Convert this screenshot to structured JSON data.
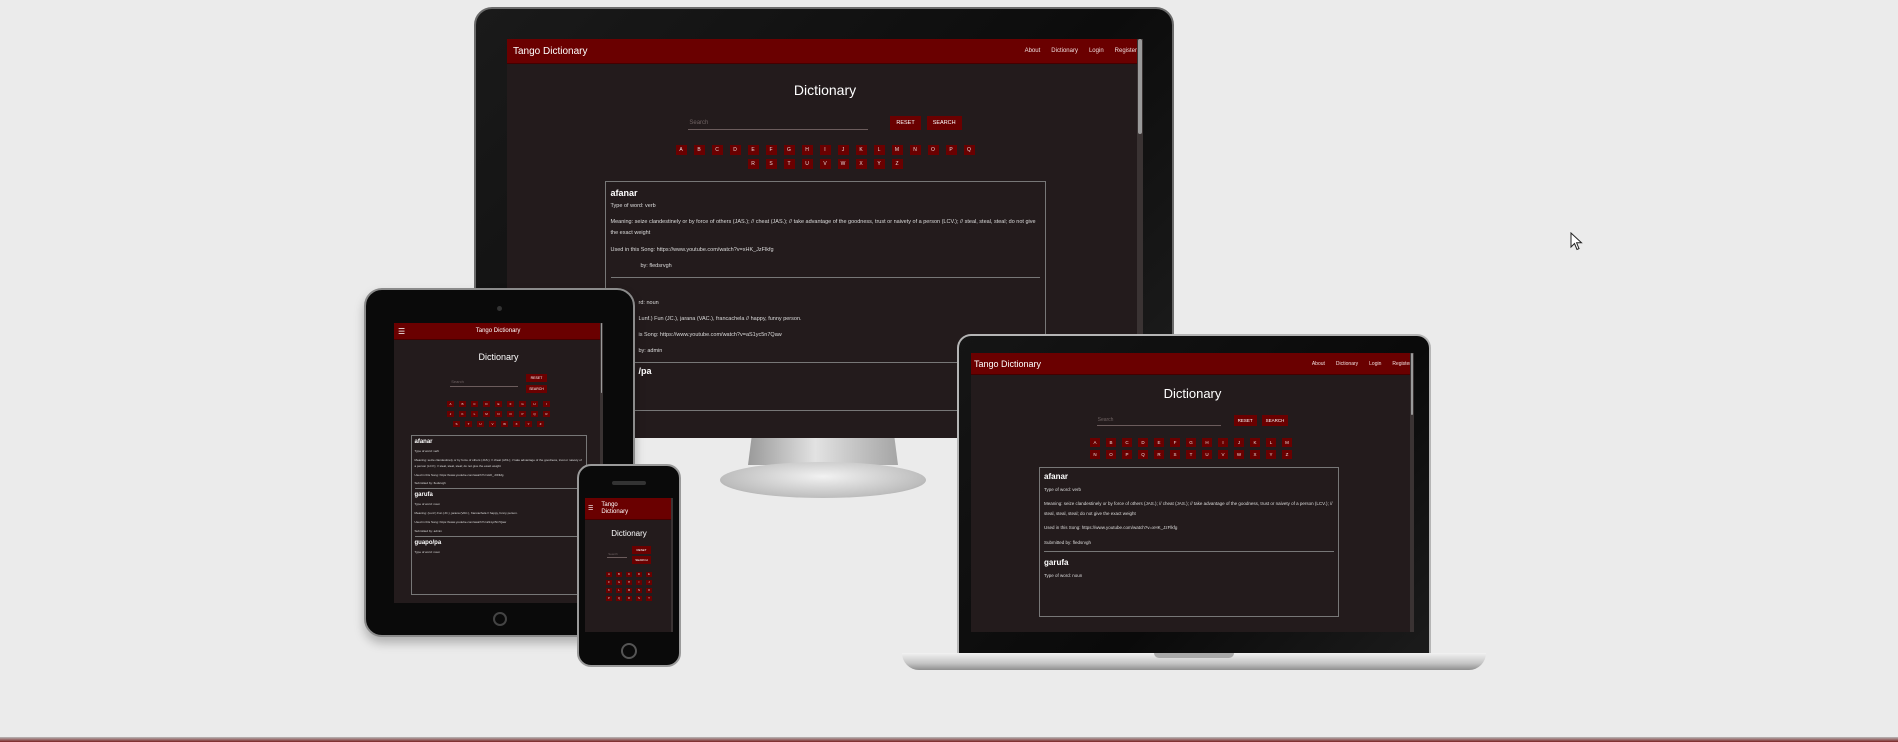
{
  "site": {
    "brand": "Tango Dictionary",
    "brand_short_l1": "Tango",
    "brand_short_l2": "Dictionary",
    "nav": [
      "About",
      "Dictionary",
      "Login",
      "Register"
    ],
    "heading": "Dictionary",
    "search_placeholder": "Search",
    "reset": "RESET",
    "search": "SEARCH",
    "letters": [
      "A",
      "B",
      "C",
      "D",
      "E",
      "F",
      "G",
      "H",
      "I",
      "J",
      "K",
      "L",
      "M",
      "N",
      "O",
      "P",
      "Q",
      "R",
      "S",
      "T",
      "U",
      "V",
      "W",
      "X",
      "Y",
      "Z"
    ],
    "entries": [
      {
        "word": "afanar",
        "type": "Type of word: verb",
        "meaning": "Meaning: seize clandestinely or by force of others (JAS.); // cheat (JAS.); // take advantage of the goodness, trust or naivety of a person (LCV.); // steal, steal, steal; do not give the exact weight",
        "song": "Used in this Song: https://www.youtube.com/watch?v=xHK_JzFlkfg",
        "submitted": "Submitted by: fledsrvgh"
      },
      {
        "word": "garufa",
        "type": "Type of word: noun",
        "meaning": "Meaning: (Lunf.) Fun (JC.), jarana (VAC.), francachela // happy, funny person.",
        "song": "Used in this Song: https://www.youtube.com/watch?v=aS1yc5n7Qaw",
        "submitted": "Submitted by: admin"
      },
      {
        "word": "guapo/pa",
        "type": "Type of word: noun"
      }
    ]
  },
  "monitor_partial": {
    "type_short": "rd: noun",
    "meaning_short": "Lunf.) Fun (JC.), jarana (VAC.), francachela // happy, funny person.",
    "song_short": "is Song: https://www.youtube.com/watch?v=aS1yc5n7Qaw",
    "submitted_short": "by: admin",
    "word_short": "/pa",
    "submitted_first_short": "by: fledsrvgh"
  },
  "colors": {
    "accent": "#6a0000",
    "screen_bg": "#231b1c",
    "page_bg": "#ebebeb"
  }
}
